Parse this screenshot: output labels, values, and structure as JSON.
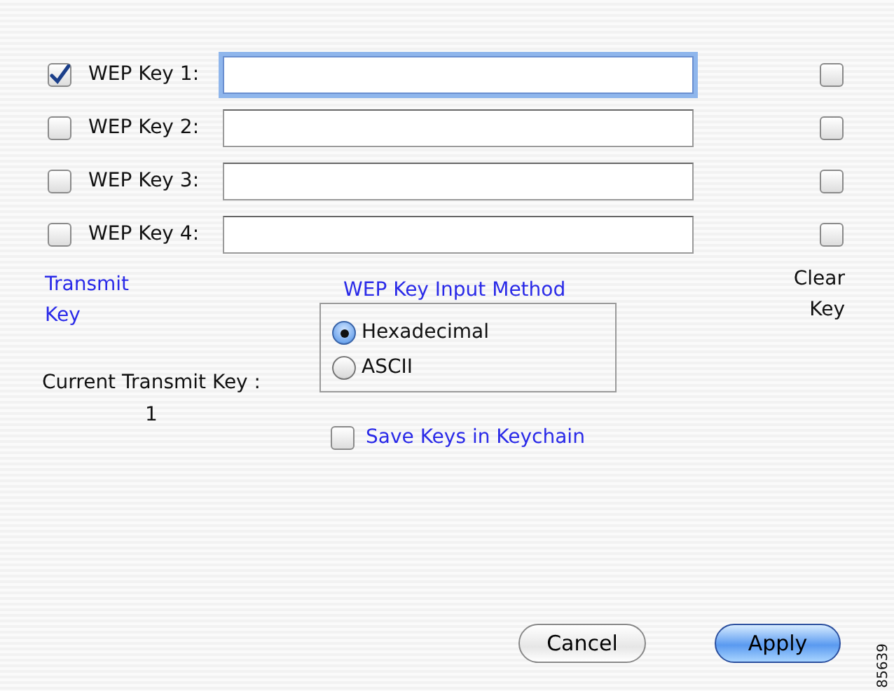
{
  "keys": [
    {
      "label": "WEP Key 1:",
      "checked": true,
      "focused": true,
      "clear": false
    },
    {
      "label": "WEP Key 2:",
      "checked": false,
      "focused": false,
      "clear": false
    },
    {
      "label": "WEP Key 3:",
      "checked": false,
      "focused": false,
      "clear": false
    },
    {
      "label": "WEP Key 4:",
      "checked": false,
      "focused": false,
      "clear": false
    }
  ],
  "transmit_key_heading": "Transmit Key",
  "clear_key_heading": "Clear Key",
  "input_method": {
    "title": "WEP Key Input Method",
    "options": [
      {
        "label": "Hexadecimal",
        "selected": true
      },
      {
        "label": "ASCII",
        "selected": false
      }
    ]
  },
  "current_transmit": "Current Transmit Key : 1",
  "save_keys": {
    "label": "Save Keys in Keychain",
    "checked": false
  },
  "buttons": [
    {
      "label": "Cancel",
      "kind": "default"
    },
    {
      "label": "Apply",
      "kind": "primary"
    }
  ],
  "figure_id": "85639"
}
